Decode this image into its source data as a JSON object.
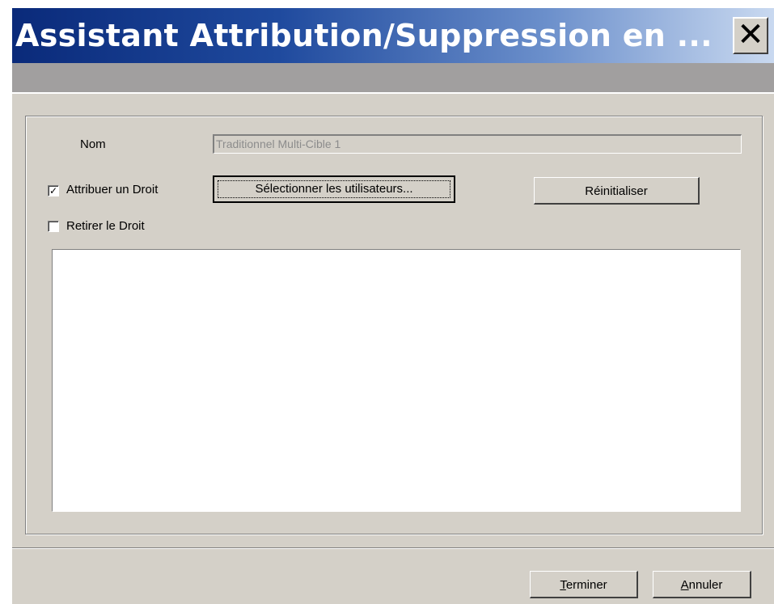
{
  "dialog": {
    "title": "Assistant Attribution/Suppression en ...",
    "close_glyph": "✕",
    "close_icon": "close-icon"
  },
  "form": {
    "nom_label": "Nom",
    "nom_value": "Traditionnel Multi-Cible 1",
    "attribuer": {
      "label": "Attribuer un Droit",
      "checked": true,
      "check_glyph": "✓"
    },
    "retirer": {
      "label": "Retirer le Droit",
      "checked": false,
      "check_glyph": ""
    },
    "select_users_label": "Sélectionner les utilisateurs...",
    "reset_label": "Réinitialiser",
    "list_items": []
  },
  "footer": {
    "terminer_mnemonic": "T",
    "terminer_rest": "erminer",
    "annuler_mnemonic": "A",
    "annuler_rest": "nnuler"
  },
  "colors": {
    "title_gradient_start": "#0a2a7a",
    "title_gradient_end": "#c9d9f0",
    "dialog_background": "#d4d0c8",
    "band": "#a19f9f"
  }
}
